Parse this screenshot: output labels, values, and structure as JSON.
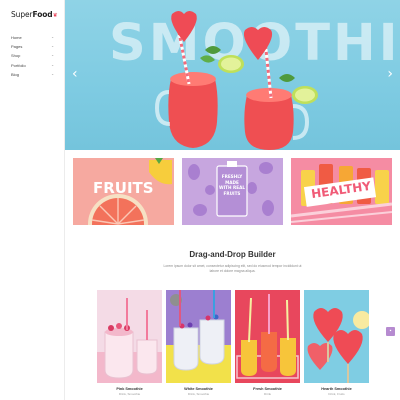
{
  "brand": {
    "name_a": "Super",
    "name_b": "Food",
    "mark": "❦"
  },
  "nav": [
    {
      "label": "Home"
    },
    {
      "label": "Pages"
    },
    {
      "label": "Shop"
    },
    {
      "label": "Portfolio"
    },
    {
      "label": "Blog"
    }
  ],
  "hero": {
    "word": "SMOOTHIES",
    "prev": "‹",
    "next": "›"
  },
  "tiles": [
    {
      "word": "FRUITS"
    },
    {
      "lines": [
        "FRESHLY",
        "MADE",
        "WITH REAL",
        "FRUITS"
      ]
    },
    {
      "word": "HEALTHY"
    }
  ],
  "section": {
    "title": "Drag-and-Drop Builder",
    "desc": "Lorem ipsum dolor sit amet, consectetur adipiscing elit, sed do eiusmod tempor incididunt ut labore et dolore magna aliqua."
  },
  "products": [
    {
      "name": "Pink Smoothie",
      "sub": "Drink, Smoothie"
    },
    {
      "name": "White Smoothie",
      "sub": "Drink, Smoothie"
    },
    {
      "name": "Fresh Smoothie",
      "sub": "Drink"
    },
    {
      "name": "Hearth Smoothie",
      "sub": "Drink, Fruits"
    }
  ],
  "badge": {
    "icon": "cart-icon"
  }
}
